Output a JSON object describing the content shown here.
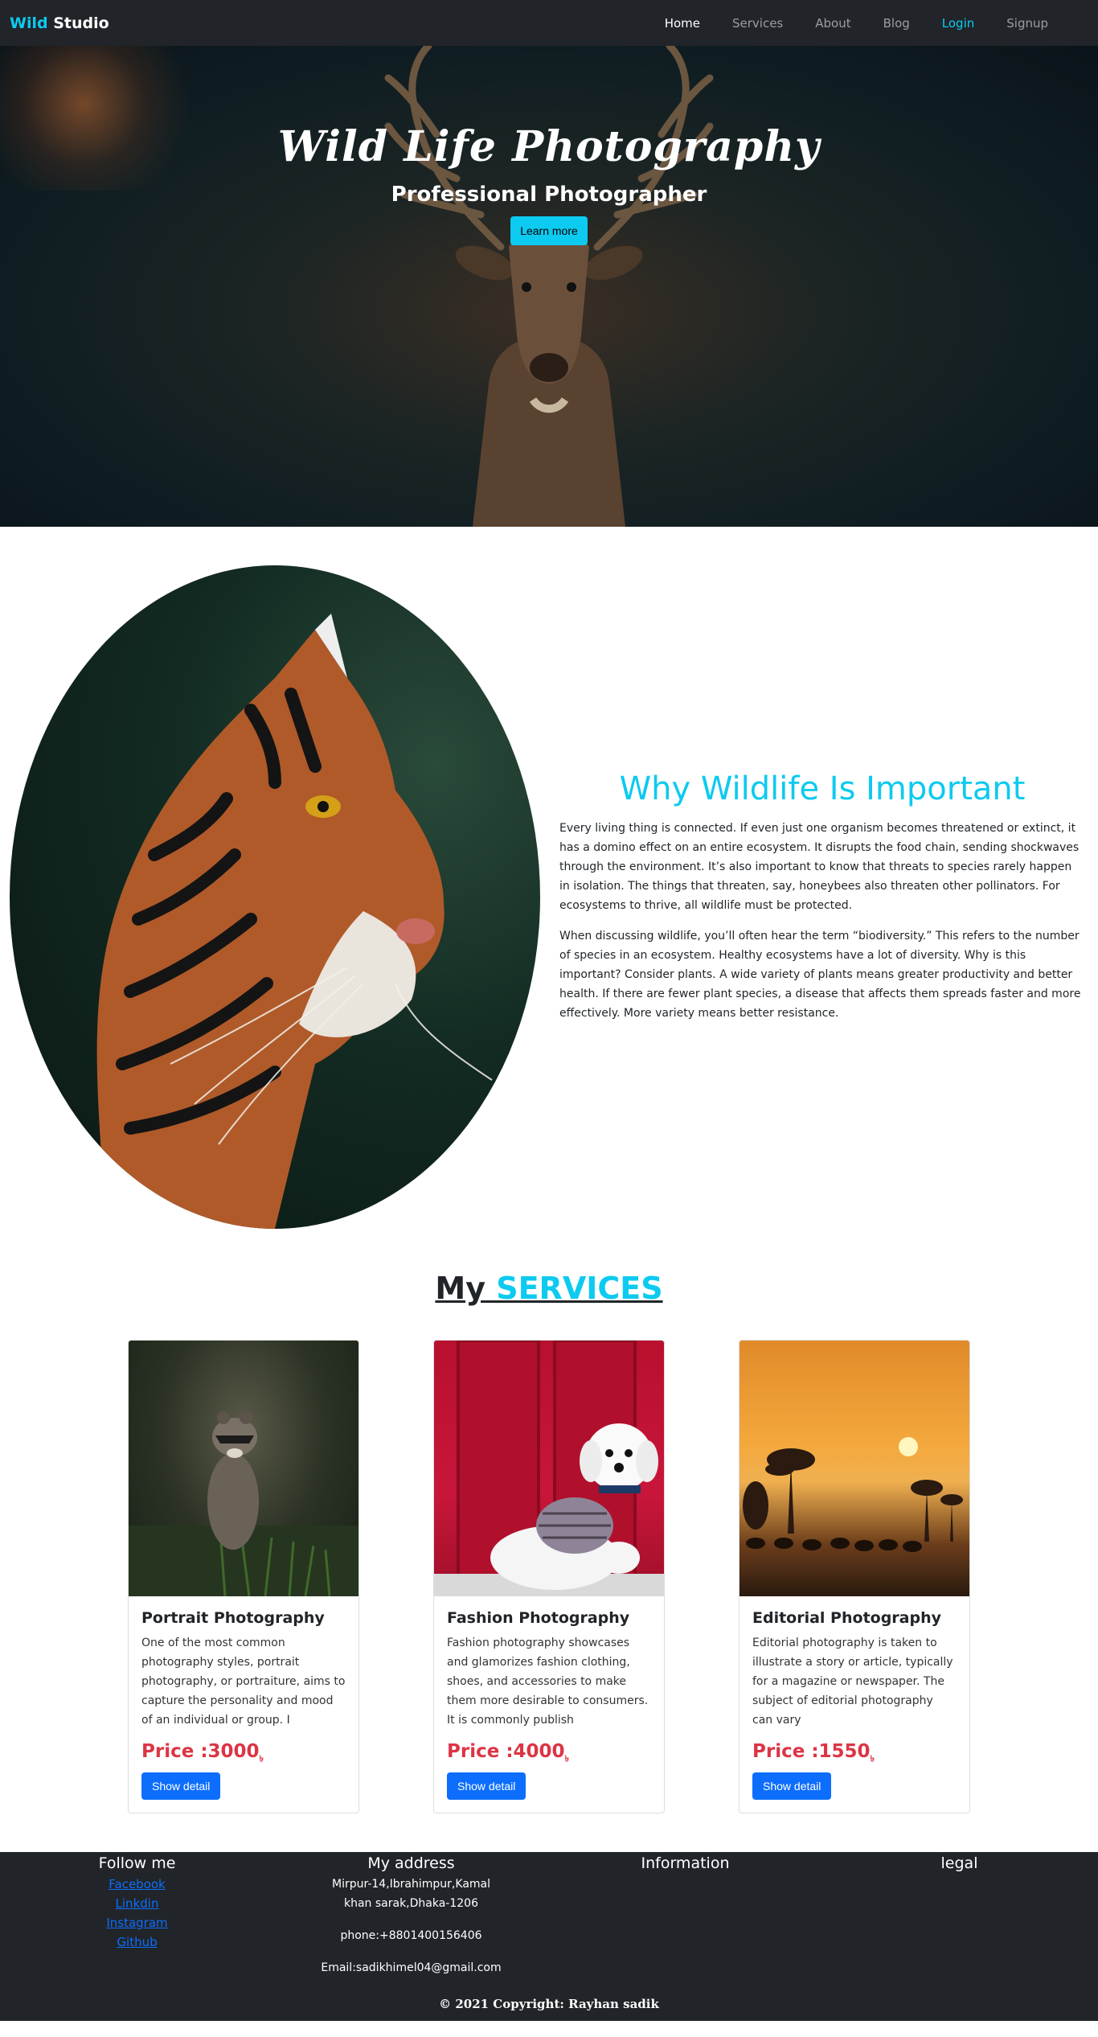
{
  "navbar": {
    "brand_part1": "Wild",
    "brand_part2": "Studio",
    "links": [
      "Home",
      "Services",
      "About",
      "Blog",
      "Login",
      "Signup"
    ]
  },
  "hero": {
    "title": "Wild Life Photography",
    "subtitle": "Professional Photographer",
    "button": "Learn more"
  },
  "why": {
    "title": "Why Wildlife Is Important",
    "paragraphs": [
      "Every living thing is connected. If even just one organism becomes threatened or extinct, it has a domino effect on an entire ecosystem. It disrupts the food chain, sending shockwaves through the environment. It’s also important to know that threats to species rarely happen in isolation. The things that threaten, say, honeybees also threaten other pollinators. For ecosystems to thrive, all wildlife must be protected.",
      "When discussing wildlife, you’ll often hear the term “biodiversity.” This refers to the number of species in an ecosystem. Healthy ecosystems have a lot of diversity. Why is this important? Consider plants. A wide variety of plants means greater productivity and better health. If there are fewer plant species, a disease that affects them spreads faster and more effectively. More variety means better resistance."
    ]
  },
  "services": {
    "title_part1": "My",
    "title_part2": " SERVICES",
    "cards": [
      {
        "title": "Portrait Photography",
        "text": "One of the most common photography styles, portrait photography, or portraiture, aims to capture the personality and mood of an individual or group. I",
        "price": "Price :3000",
        "currency": "৳",
        "button": "Show detail"
      },
      {
        "title": "Fashion Photography",
        "text": "Fashion photography showcases and glamorizes fashion clothing, shoes, and accessories to make them more desirable to consumers. It is commonly publish",
        "price": "Price :4000",
        "currency": "৳",
        "button": "Show detail"
      },
      {
        "title": "Editorial Photography",
        "text": "Editorial photography is taken to illustrate a story or article, typically for a magazine or newspaper. The subject of editorial photography can vary",
        "price": "Price :1550",
        "currency": "৳",
        "button": "Show detail"
      }
    ]
  },
  "footer": {
    "follow_title": "Follow me",
    "follow_links": [
      "Facebook",
      "Linkdin",
      "Instagram",
      "Github"
    ],
    "address_title": "My address",
    "address": "Mirpur-14,Ibrahimpur,Kamal khan sarak,Dhaka-1206",
    "phone": "phone:+8801400156406",
    "email": "Email:sadikhimel04@gmail.com",
    "info_title": "Information",
    "legal_title": "legal",
    "copyright": "© 2021 Copyright: Rayhan sadik"
  },
  "colors": {
    "accent": "#0dcaf0",
    "primary": "#0d6efd",
    "danger": "#dc3545",
    "dark": "#212529"
  }
}
